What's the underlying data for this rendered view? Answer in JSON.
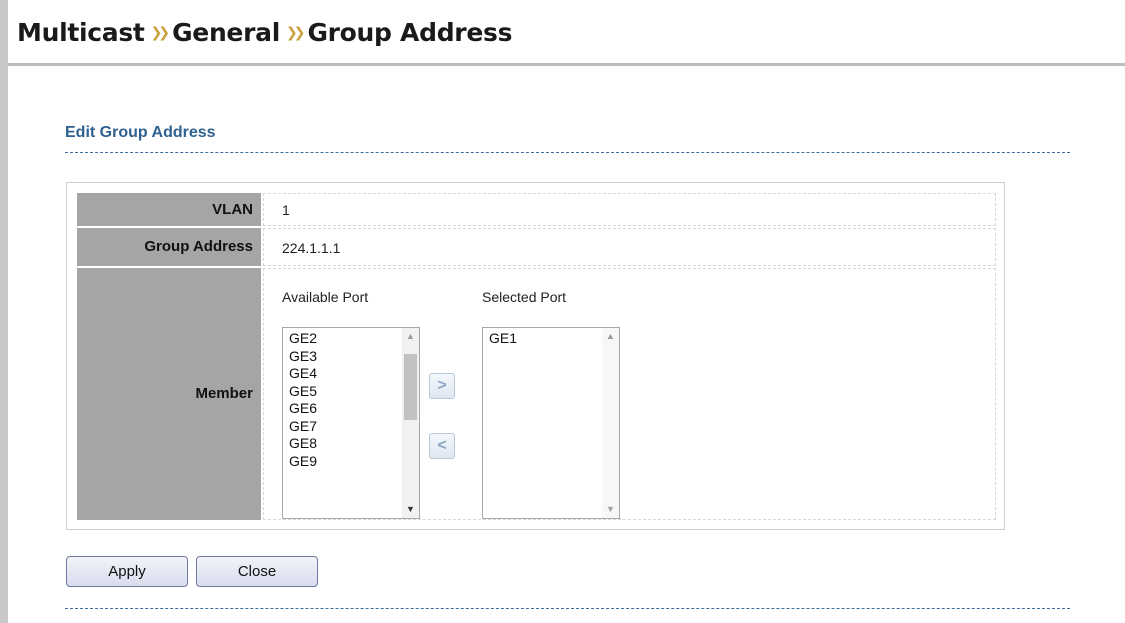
{
  "breadcrumb": {
    "items": [
      "Multicast",
      "General",
      "Group Address"
    ],
    "separator": "»"
  },
  "section": {
    "title": "Edit Group Address"
  },
  "form": {
    "vlan": {
      "label": "VLAN",
      "value": "1"
    },
    "group_address": {
      "label": "Group Address",
      "value": "224.1.1.1"
    },
    "member": {
      "label": "Member",
      "available_title": "Available Port",
      "selected_title": "Selected Port",
      "available_ports": [
        "GE2",
        "GE3",
        "GE4",
        "GE5",
        "GE6",
        "GE7",
        "GE8",
        "GE9"
      ],
      "selected_ports": [
        "GE1"
      ],
      "add_symbol": ">",
      "remove_symbol": "<"
    }
  },
  "buttons": {
    "apply": "Apply",
    "close": "Close"
  },
  "colors": {
    "label_bg": "#a5a5a5",
    "section_title": "#2f6190",
    "breadcrumb_separator": "#c9a13c"
  }
}
